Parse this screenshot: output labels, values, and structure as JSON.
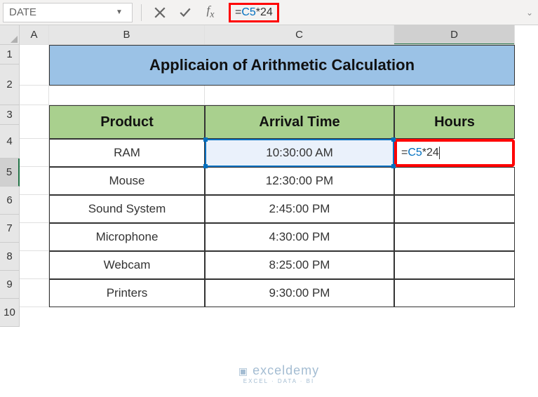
{
  "namebox": {
    "value": "DATE"
  },
  "formula": {
    "eq": "=",
    "ref": "C5",
    "op": "*",
    "num": "24"
  },
  "columns": [
    "A",
    "B",
    "C",
    "D"
  ],
  "rows": [
    "1",
    "2",
    "3",
    "4",
    "5",
    "6",
    "7",
    "8",
    "9",
    "10"
  ],
  "title": "Applicaion of Arithmetic Calculation",
  "headers": {
    "product": "Product",
    "arrival": "Arrival Time",
    "hours": "Hours"
  },
  "data": [
    {
      "product": "RAM",
      "time": "10:30:00 AM"
    },
    {
      "product": "Mouse",
      "time": "12:30:00 PM"
    },
    {
      "product": "Sound System",
      "time": "2:45:00 PM"
    },
    {
      "product": "Microphone",
      "time": "4:30:00 PM"
    },
    {
      "product": "Webcam",
      "time": "8:25:00 PM"
    },
    {
      "product": "Printers",
      "time": "9:30:00 PM"
    }
  ],
  "editing": {
    "eq": "=",
    "ref": "C5",
    "op": "*",
    "num": "24"
  },
  "watermark": {
    "brand": "exceldemy",
    "tag": "EXCEL · DATA · BI"
  }
}
